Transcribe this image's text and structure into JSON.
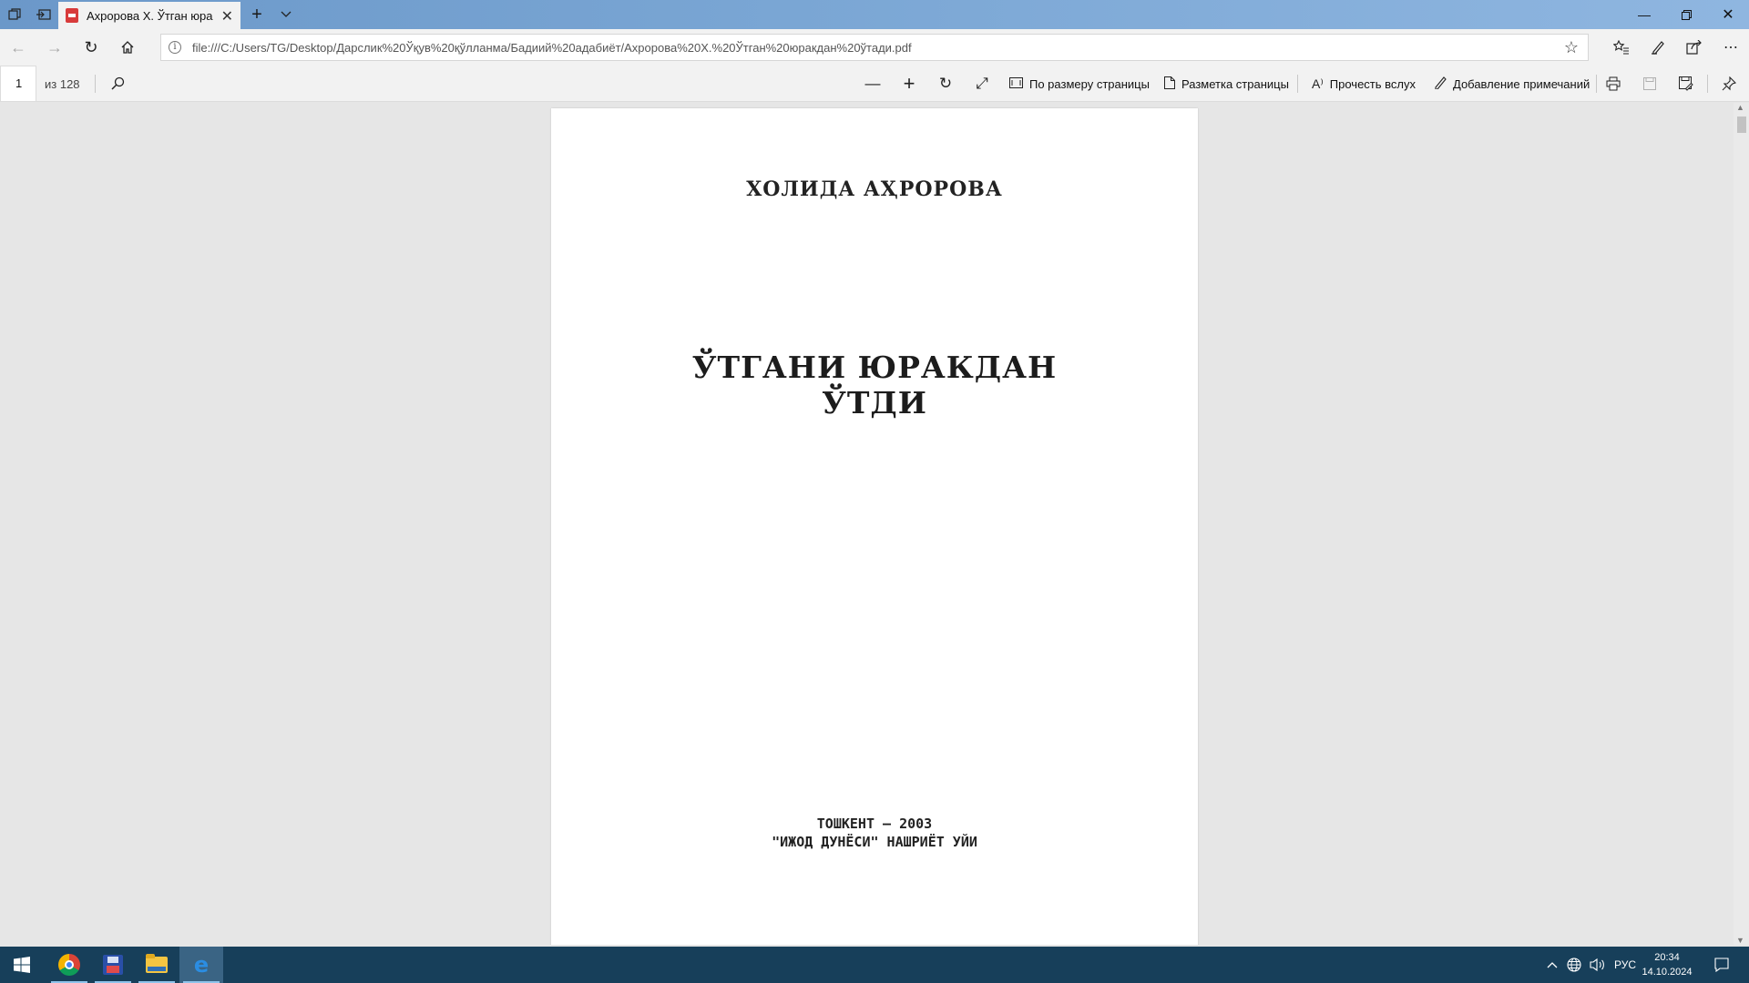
{
  "browser": {
    "tab": {
      "title": "Ахророва Х. Ўтган юра"
    },
    "address": {
      "url": "file:///C:/Users/TG/Desktop/Дарслик%20Ўқув%20қўлланма/Бадиий%20адабиёт/Ахророва%20Х.%20Ўтган%20юракдан%20ўтади.pdf"
    }
  },
  "pdf_toolbar": {
    "page_number": "1",
    "page_total": "из 128",
    "fit_page": "По размеру страницы",
    "page_layout": "Разметка страницы",
    "read_aloud": "Прочесть вслух",
    "add_notes": "Добавление примечаний"
  },
  "document": {
    "author": "ХОЛИДА АҲРОРОВА",
    "title_line1": "ЎТГАНИ ЮРАКДАН",
    "title_line2": "ЎТДИ",
    "city_year": "ТОШКЕНТ — 2003",
    "publisher": "\"ИЖОД ДУНЁСИ\" НАШРИЁТ УЙИ"
  },
  "taskbar": {
    "apps": [
      "chrome-icon",
      "save-icon",
      "file-explorer-icon",
      "edge-icon"
    ],
    "language": "РУС",
    "time": "20:34",
    "date": "14.10.2024"
  },
  "colors": {
    "tabbar_gradient_start": "#6b98c9",
    "taskbar": "#173f5a",
    "viewer_background": "#e6e6e6"
  }
}
